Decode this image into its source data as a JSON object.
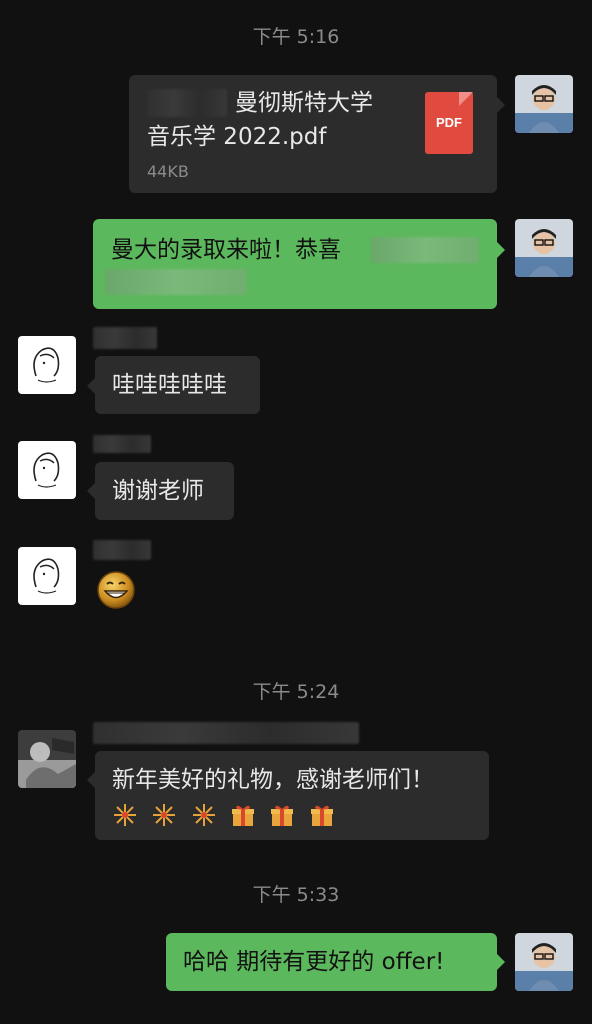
{
  "timestamps": [
    "下午 5:16",
    "下午 5:24",
    "下午 5:33"
  ],
  "messages": {
    "file": {
      "name_line1": "曼彻斯特大学",
      "name_line2": "音乐学 2022.pdf",
      "size": "44KB",
      "icon_label": "PDF"
    },
    "admit": {
      "line1": "曼大的录取来啦！恭喜"
    },
    "wow": {
      "text": "哇哇哇哇哇"
    },
    "thanks": {
      "text": "谢谢老师"
    },
    "gift": {
      "text": "新年美好的礼物，感谢老师们！"
    },
    "reply": {
      "text": "哈哈 期待有更好的 offer!"
    }
  },
  "icons": {
    "pdf": "pdf-file-icon",
    "emoji_grin": "grinning-face-emoji",
    "fireworks": "fireworks-emoji",
    "gift": "wrapped-gift-emoji"
  },
  "colors": {
    "background": "#111111",
    "bubble_self": "#5cb85c",
    "bubble_other": "#2c2c2c",
    "pdf": "#e04a3f"
  }
}
